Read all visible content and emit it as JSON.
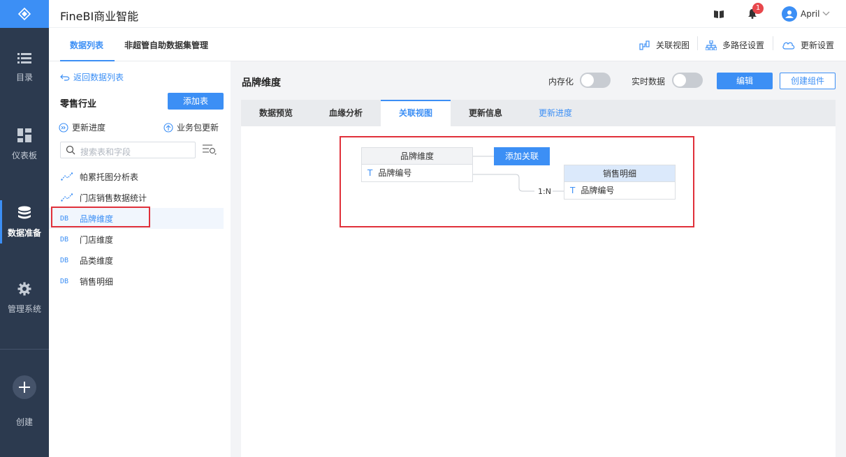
{
  "nav": {
    "items": [
      {
        "label": "目录",
        "icon": "list-icon"
      },
      {
        "label": "仪表板",
        "icon": "dashboard-icon"
      },
      {
        "label": "数据准备",
        "icon": "database-icon"
      },
      {
        "label": "管理系统",
        "icon": "gear-icon"
      }
    ],
    "create_label": "创建"
  },
  "header": {
    "app_title": "FineBI商业智能",
    "notification_count": "1",
    "user_name": "April"
  },
  "top_tabs": [
    "数据列表",
    "非超管自助数据集管理"
  ],
  "right_links": {
    "relation_view": "关联视图",
    "multipath": "多路径设置",
    "update_settings": "更新设置"
  },
  "sidebar": {
    "back_label": "返回数据列表",
    "package_title": "零售行业",
    "add_table_label": "添加表",
    "update_progress_label": "更新进度",
    "package_update_label": "业务包更新",
    "search_placeholder": "搜索表和字段",
    "tables": [
      {
        "icon": "analysis",
        "name": "帕累托图分析表"
      },
      {
        "icon": "analysis",
        "name": "门店销售数据统计"
      },
      {
        "icon": "DB",
        "name": "品牌维度",
        "selected": true
      },
      {
        "icon": "DB",
        "name": "门店维度"
      },
      {
        "icon": "DB",
        "name": "品类维度"
      },
      {
        "icon": "DB",
        "name": "销售明细"
      }
    ]
  },
  "main": {
    "title": "品牌维度",
    "memory_label": "内存化",
    "realtime_label": "实时数据",
    "edit_label": "编辑",
    "create_component_label": "创建组件",
    "tabs": [
      "数据预览",
      "血缘分析",
      "关联视图",
      "更新信息",
      "更新进度"
    ],
    "active_tab": "关联视图",
    "diagram": {
      "add_relation_label": "添加关联",
      "source": {
        "title": "品牌维度",
        "field_type": "T",
        "field": "品牌编号"
      },
      "target": {
        "title": "销售明细",
        "field_type": "T",
        "field": "品牌编号"
      },
      "relation": "1:N"
    }
  },
  "colors": {
    "nav_bg": "#2c3a4f",
    "accent": "#3c8ff5",
    "highlight_border": "#e0303a"
  }
}
